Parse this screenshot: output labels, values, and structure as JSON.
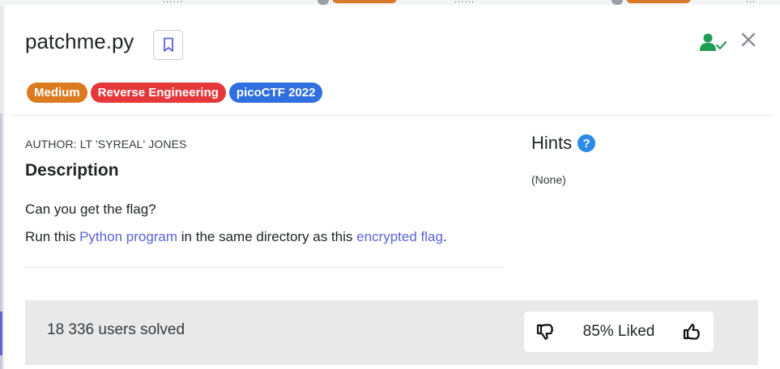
{
  "modal": {
    "title": "patchme.py",
    "tags": {
      "difficulty": "Medium",
      "category": "Reverse Engineering",
      "event": "picoCTF 2022"
    },
    "author": "AUTHOR: LT 'SYREAL' JONES",
    "description": {
      "heading": "Description",
      "line1": "Can you get the flag?",
      "line2_prefix": "Run this ",
      "line2_link1": "Python program",
      "line2_middle": " in the same directory as this ",
      "line2_link2": "encrypted flag",
      "line2_suffix": "."
    },
    "hints": {
      "heading": "Hints",
      "help_symbol": "?",
      "value": "(None)"
    },
    "footer": {
      "solved": "18 336 users solved",
      "liked": "85% Liked"
    }
  },
  "colors": {
    "medium": "#db7a1f",
    "category": "#e5383b",
    "event": "#2f6fe0",
    "link": "#5b63d6",
    "solved_icon": "#1f9d55"
  },
  "icons": {
    "bookmark": "bookmark-icon",
    "user_check": "user-check-icon",
    "close": "close-icon",
    "help": "help-icon",
    "thumb_down": "thumbs-down-icon",
    "thumb_up": "thumbs-up-icon"
  }
}
